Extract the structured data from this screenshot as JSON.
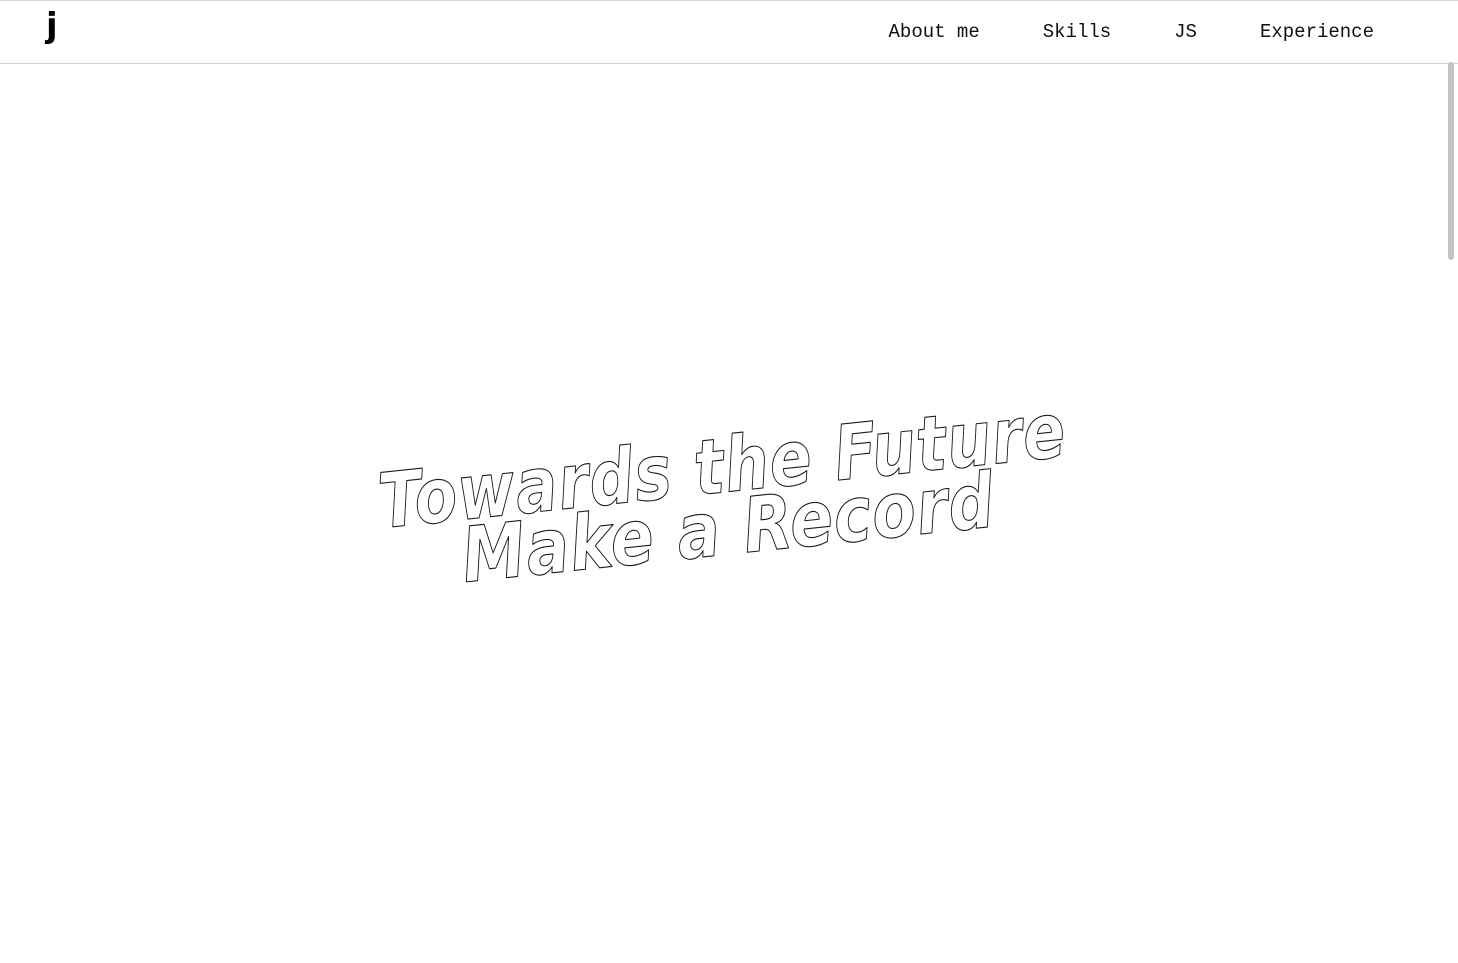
{
  "header": {
    "logo": "j",
    "nav": [
      {
        "label": "About me"
      },
      {
        "label": "Skills"
      },
      {
        "label": "JS"
      },
      {
        "label": "Experience"
      }
    ]
  },
  "hero": {
    "line1": "Towards the Future",
    "line2": "Make a Record"
  },
  "colors": {
    "background": "#ffffff",
    "text": "#111111",
    "outline": "#1a1a1a",
    "divider": "#cfcfcf",
    "scrollbar_thumb": "#c4c4c4"
  },
  "scroll": {
    "position_fraction": 0
  }
}
